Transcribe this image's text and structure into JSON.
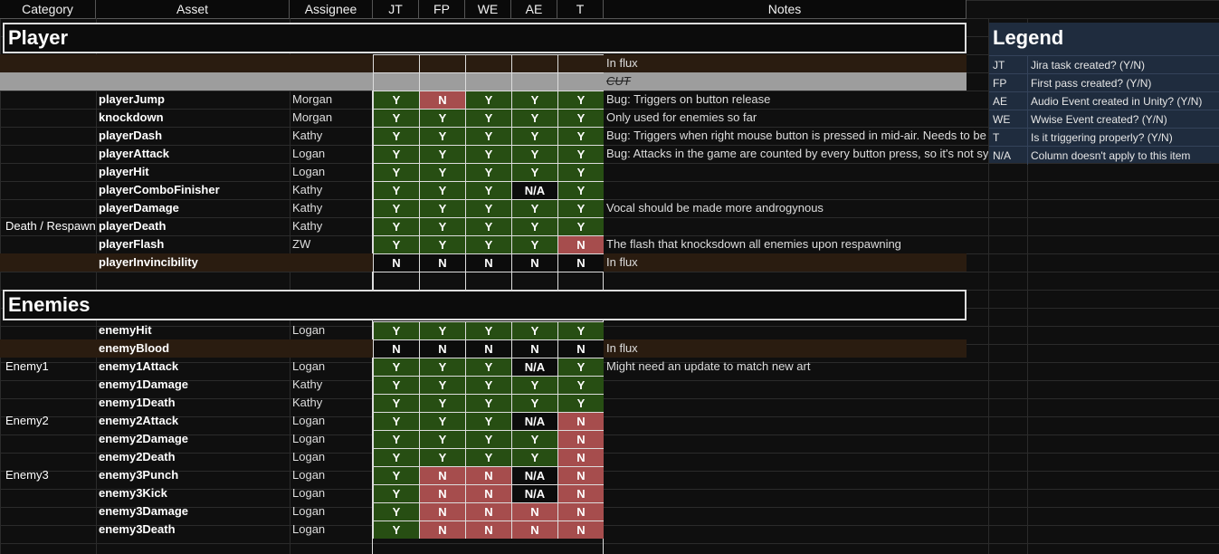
{
  "headers": [
    "Category",
    "Asset",
    "Assignee",
    "JT",
    "FP",
    "WE",
    "AE",
    "T",
    "Notes"
  ],
  "sections": {
    "player": "Player",
    "enemies": "Enemies"
  },
  "player_rows": [
    {
      "cat": "",
      "asset": "",
      "assignee": "",
      "flags": [
        "",
        "",
        "",
        "",
        ""
      ],
      "notes": "In flux",
      "style": "flux"
    },
    {
      "cat": "",
      "asset": "",
      "assignee": "",
      "flags": [
        "",
        "",
        "",
        "",
        ""
      ],
      "notes": "CUT",
      "style": "cut"
    },
    {
      "cat": "",
      "asset": "playerJump",
      "assignee": "Morgan",
      "flags": [
        "Y",
        "N",
        "Y",
        "Y",
        "Y"
      ],
      "notes": "Bug: Triggers on button release"
    },
    {
      "cat": "",
      "asset": "knockdown",
      "assignee": "Morgan",
      "flags": [
        "Y",
        "Y",
        "Y",
        "Y",
        "Y"
      ],
      "notes": "Only used for enemies so far"
    },
    {
      "cat": "",
      "asset": "playerDash",
      "assignee": "Kathy",
      "flags": [
        "Y",
        "Y",
        "Y",
        "Y",
        "Y"
      ],
      "notes": "Bug: Triggers when right mouse button is pressed in mid-air. Needs to be a li"
    },
    {
      "cat": "",
      "asset": "playerAttack",
      "assignee": "Logan",
      "flags": [
        "Y",
        "Y",
        "Y",
        "Y",
        "Y"
      ],
      "notes": "Bug: Attacks in the game are counted by every button press, so it's not synce"
    },
    {
      "cat": "",
      "asset": "playerHit",
      "assignee": "Logan",
      "flags": [
        "Y",
        "Y",
        "Y",
        "Y",
        "Y"
      ],
      "notes": ""
    },
    {
      "cat": "",
      "asset": "playerComboFinisher",
      "assignee": "Kathy",
      "flags": [
        "Y",
        "Y",
        "Y",
        "N/A",
        "Y"
      ],
      "notes": ""
    },
    {
      "cat": "",
      "asset": "playerDamage",
      "assignee": "Kathy",
      "flags": [
        "Y",
        "Y",
        "Y",
        "Y",
        "Y"
      ],
      "notes": "Vocal should be made more androgynous"
    },
    {
      "cat": "Death / Respawn",
      "asset": "playerDeath",
      "assignee": "Kathy",
      "flags": [
        "Y",
        "Y",
        "Y",
        "Y",
        "Y"
      ],
      "notes": ""
    },
    {
      "cat": "",
      "asset": "playerFlash",
      "assignee": "ZW",
      "flags": [
        "Y",
        "Y",
        "Y",
        "Y",
        "N"
      ],
      "notes": "The flash that knocksdown all enemies upon respawning"
    },
    {
      "cat": "",
      "asset": "playerInvincibility",
      "assignee": "",
      "flags": [
        "N",
        "N",
        "N",
        "N",
        "N"
      ],
      "notes": "In flux",
      "style": "flux"
    },
    {
      "cat": "",
      "asset": "",
      "assignee": "",
      "flags": [
        "",
        "",
        "",
        "",
        ""
      ],
      "notes": ""
    }
  ],
  "enemy_rows": [
    {
      "cat": "",
      "asset": "enemyHit",
      "assignee": "Logan",
      "flags": [
        "Y",
        "Y",
        "Y",
        "Y",
        "Y"
      ],
      "notes": ""
    },
    {
      "cat": "",
      "asset": "enemyBlood",
      "assignee": "",
      "flags": [
        "N",
        "N",
        "N",
        "N",
        "N"
      ],
      "notes": "In flux",
      "style": "flux"
    },
    {
      "cat": "Enemy1",
      "asset": "enemy1Attack",
      "assignee": "Logan",
      "flags": [
        "Y",
        "Y",
        "Y",
        "N/A",
        "Y"
      ],
      "notes": "Might need an update to match new art"
    },
    {
      "cat": "",
      "asset": "enemy1Damage",
      "assignee": "Kathy",
      "flags": [
        "Y",
        "Y",
        "Y",
        "Y",
        "Y"
      ],
      "notes": ""
    },
    {
      "cat": "",
      "asset": "enemy1Death",
      "assignee": "Kathy",
      "flags": [
        "Y",
        "Y",
        "Y",
        "Y",
        "Y"
      ],
      "notes": ""
    },
    {
      "cat": "Enemy2",
      "asset": "enemy2Attack",
      "assignee": "Logan",
      "flags": [
        "Y",
        "Y",
        "Y",
        "N/A",
        "N"
      ],
      "notes": ""
    },
    {
      "cat": "",
      "asset": "enemy2Damage",
      "assignee": "Logan",
      "flags": [
        "Y",
        "Y",
        "Y",
        "Y",
        "N"
      ],
      "notes": ""
    },
    {
      "cat": "",
      "asset": "enemy2Death",
      "assignee": "Logan",
      "flags": [
        "Y",
        "Y",
        "Y",
        "Y",
        "N"
      ],
      "notes": ""
    },
    {
      "cat": "Enemy3",
      "asset": "enemy3Punch",
      "assignee": "Logan",
      "flags": [
        "Y",
        "N",
        "N",
        "N/A",
        "N"
      ],
      "notes": ""
    },
    {
      "cat": "",
      "asset": "enemy3Kick",
      "assignee": "Logan",
      "flags": [
        "Y",
        "N",
        "N",
        "N/A",
        "N"
      ],
      "notes": ""
    },
    {
      "cat": "",
      "asset": "enemy3Damage",
      "assignee": "Logan",
      "flags": [
        "Y",
        "N",
        "N",
        "N",
        "N"
      ],
      "notes": ""
    },
    {
      "cat": "",
      "asset": "enemy3Death",
      "assignee": "Logan",
      "flags": [
        "Y",
        "N",
        "N",
        "N",
        "N"
      ],
      "notes": ""
    }
  ],
  "legend": {
    "title": "Legend",
    "items": [
      {
        "key": "JT",
        "desc": "Jira task created? (Y/N)"
      },
      {
        "key": "FP",
        "desc": "First pass created? (Y/N)"
      },
      {
        "key": "AE",
        "desc": "Audio Event created in Unity? (Y/N)"
      },
      {
        "key": "WE",
        "desc": "Wwise Event created? (Y/N)"
      },
      {
        "key": "T",
        "desc": "Is it triggering properly? (Y/N)"
      },
      {
        "key": "N/A",
        "desc": "Column doesn't apply to this item"
      }
    ]
  },
  "colors": {
    "yes": "#274e13",
    "no_red": "#a64d4d",
    "flux": "#2a1c10",
    "cut": "#9d9d9d",
    "legend": "#1f2c3e"
  }
}
